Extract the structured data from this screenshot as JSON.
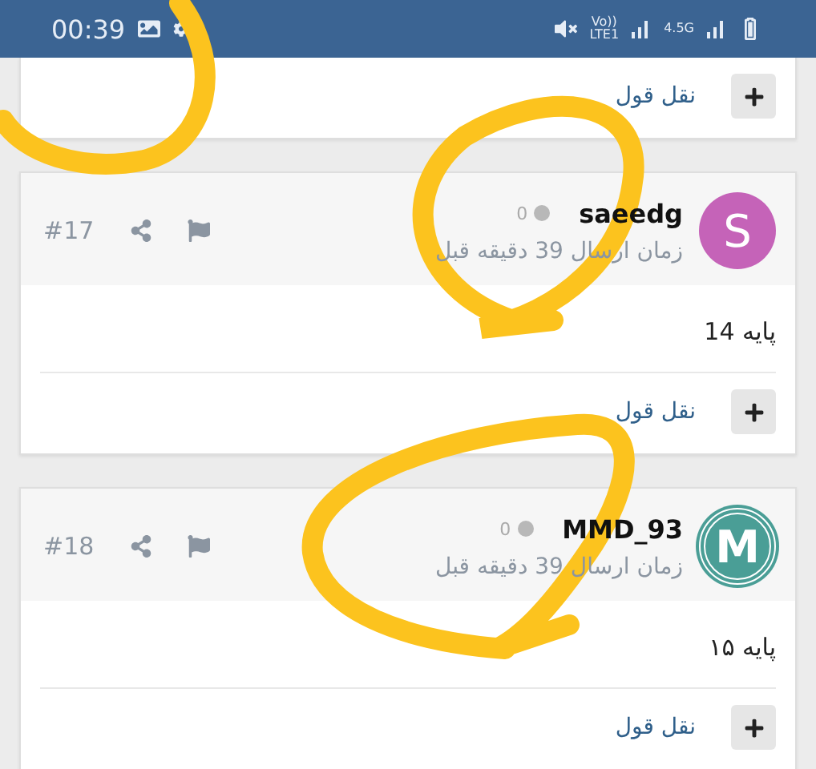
{
  "status_bar": {
    "time": "00:39",
    "network_1": "Vo)) LTE1",
    "network_2": "4.5G"
  },
  "previous_post": {
    "quote_label": "نقل قول"
  },
  "posts": [
    {
      "author": "saeedg",
      "avatar": {
        "kind": "letter",
        "letter": "S",
        "color": "#c563b8"
      },
      "reputation": "0",
      "time": "زمان ارسال 39 دقیقه قبل",
      "number": "#17",
      "body": "پایه 14",
      "quote_label": "نقل قول"
    },
    {
      "author": "MMD_93",
      "avatar": {
        "kind": "badge",
        "letter": "M",
        "color": "#4a9e96"
      },
      "reputation": "0",
      "time": "زمان ارسال 39 دقیقه قبل",
      "number": "#18",
      "body": "پایه ۱۵",
      "quote_label": "نقل قول"
    }
  ]
}
